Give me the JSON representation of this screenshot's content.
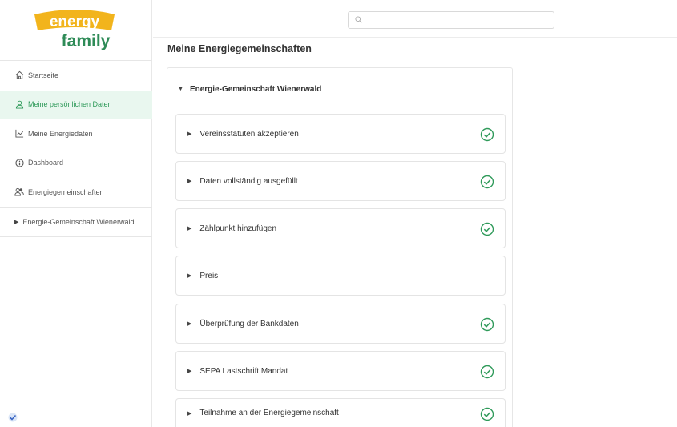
{
  "logo": {
    "line1": "energy",
    "line2": "family"
  },
  "search": {
    "placeholder": "",
    "value": ""
  },
  "nav": [
    {
      "label": "Startseite",
      "icon": "home-icon"
    },
    {
      "label": "Meine persönlichen Daten",
      "icon": "user-icon",
      "active": true
    },
    {
      "label": "Meine Energiedaten",
      "icon": "chart-line-icon"
    },
    {
      "label": "Dashboard",
      "icon": "info-circle-icon"
    },
    {
      "label": "Energiegemeinschaften",
      "icon": "users-icon"
    },
    {
      "label": "Energie-Gemeinschaft Wienerwald",
      "icon": "caret-right-icon"
    }
  ],
  "main": {
    "title": "Meine Energiegemeinschaften",
    "group_title": "Energie-Gemeinschaft Wienerwald",
    "steps": [
      {
        "label": "Vereinsstatuten akzeptieren",
        "done": true
      },
      {
        "label": "Daten vollständig ausgefüllt",
        "done": true
      },
      {
        "label": "Zählpunkt hinzufügen",
        "done": true
      },
      {
        "label": "Preis",
        "done": false
      },
      {
        "label": "Überprüfung der Bankdaten",
        "done": true
      },
      {
        "label": "SEPA Lastschrift Mandat",
        "done": true
      },
      {
        "label": "Teilnahme an der Energiegemeinschaft",
        "done": true
      }
    ]
  },
  "colors": {
    "accent_green": "#2f9a5a",
    "logo_gold": "#f2b41c",
    "logo_green": "#2e8b57",
    "active_bg": "#e9f7ef"
  }
}
